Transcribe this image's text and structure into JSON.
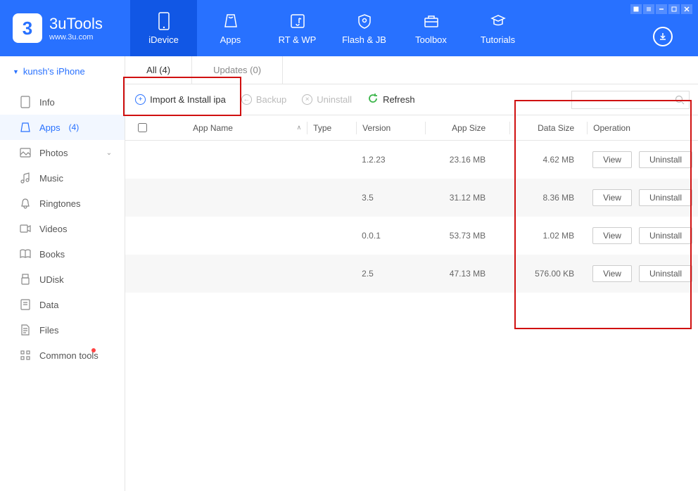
{
  "app": {
    "name": "3uTools",
    "subtitle": "www.3u.com"
  },
  "nav": [
    {
      "label": "iDevice",
      "active": true
    },
    {
      "label": "Apps",
      "active": false
    },
    {
      "label": "RT & WP",
      "active": false
    },
    {
      "label": "Flash & JB",
      "active": false
    },
    {
      "label": "Toolbox",
      "active": false
    },
    {
      "label": "Tutorials",
      "active": false
    }
  ],
  "device": {
    "name": "kunsh's iPhone"
  },
  "sidebar": [
    {
      "label": "Info",
      "icon": "info"
    },
    {
      "label": "Apps",
      "count": "(4)",
      "icon": "apps",
      "active": true
    },
    {
      "label": "Photos",
      "icon": "photos",
      "expandable": true
    },
    {
      "label": "Music",
      "icon": "music"
    },
    {
      "label": "Ringtones",
      "icon": "bell"
    },
    {
      "label": "Videos",
      "icon": "video"
    },
    {
      "label": "Books",
      "icon": "book"
    },
    {
      "label": "UDisk",
      "icon": "udisk"
    },
    {
      "label": "Data",
      "icon": "data"
    },
    {
      "label": "Files",
      "icon": "files"
    },
    {
      "label": "Common tools",
      "icon": "grid",
      "dot": true
    }
  ],
  "subTabs": [
    {
      "label": "All (4)",
      "active": true
    },
    {
      "label": "Updates (0)",
      "active": false
    }
  ],
  "toolbar": {
    "import": "Import & Install ipa",
    "backup": "Backup",
    "uninstall": "Uninstall",
    "refresh": "Refresh"
  },
  "columns": {
    "name": "App Name",
    "type": "Type",
    "version": "Version",
    "appsize": "App Size",
    "datasize": "Data Size",
    "operation": "Operation"
  },
  "rows": [
    {
      "version": "1.2.23",
      "appsize": "23.16 MB",
      "datasize": "4.62 MB"
    },
    {
      "version": "3.5",
      "appsize": "31.12 MB",
      "datasize": "8.36 MB"
    },
    {
      "version": "0.0.1",
      "appsize": "53.73 MB",
      "datasize": "1.02 MB"
    },
    {
      "version": "2.5",
      "appsize": "47.13 MB",
      "datasize": "576.00 KB"
    }
  ],
  "buttons": {
    "view": "View",
    "uninstall": "Uninstall"
  }
}
